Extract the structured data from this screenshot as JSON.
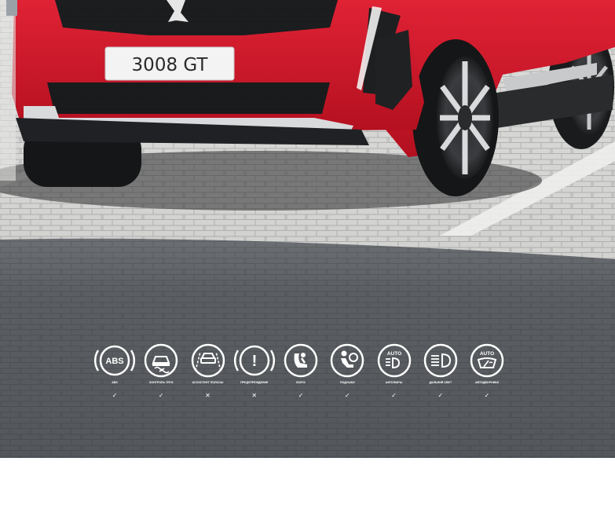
{
  "car": {
    "plate": "3008 GT"
  },
  "features": [
    {
      "icon": "abs-icon",
      "badge": "ABS",
      "label": "ABS",
      "available": true,
      "mark": "✓"
    },
    {
      "icon": "traction-control-icon",
      "badge": "",
      "label": "Контроль тяги",
      "available": true,
      "mark": "✓"
    },
    {
      "icon": "lane-assist-icon",
      "badge": "",
      "label": "Ассистент полосы",
      "available": false,
      "mark": "✕"
    },
    {
      "icon": "warning-icon",
      "badge": "!",
      "label": "Предупреждение",
      "available": false,
      "mark": "✕"
    },
    {
      "icon": "child-seat-icon",
      "badge": "",
      "label": "Isofix",
      "available": true,
      "mark": "✓"
    },
    {
      "icon": "airbag-icon",
      "badge": "",
      "label": "Подушки",
      "available": true,
      "mark": "✓"
    },
    {
      "icon": "auto-headlights-icon",
      "badge": "AUTO",
      "label": "Автофары",
      "available": true,
      "mark": "✓"
    },
    {
      "icon": "high-beam-icon",
      "badge": "",
      "label": "Дальний свет",
      "available": true,
      "mark": "✓"
    },
    {
      "icon": "auto-wipers-icon",
      "badge": "AUTO",
      "label": "Автодворники",
      "available": true,
      "mark": "✓"
    }
  ],
  "colors": {
    "car_body": "#d3142a",
    "pavement": "#8a8b8e",
    "shadow": "#4f5256",
    "icon_stroke": "#ffffff"
  }
}
